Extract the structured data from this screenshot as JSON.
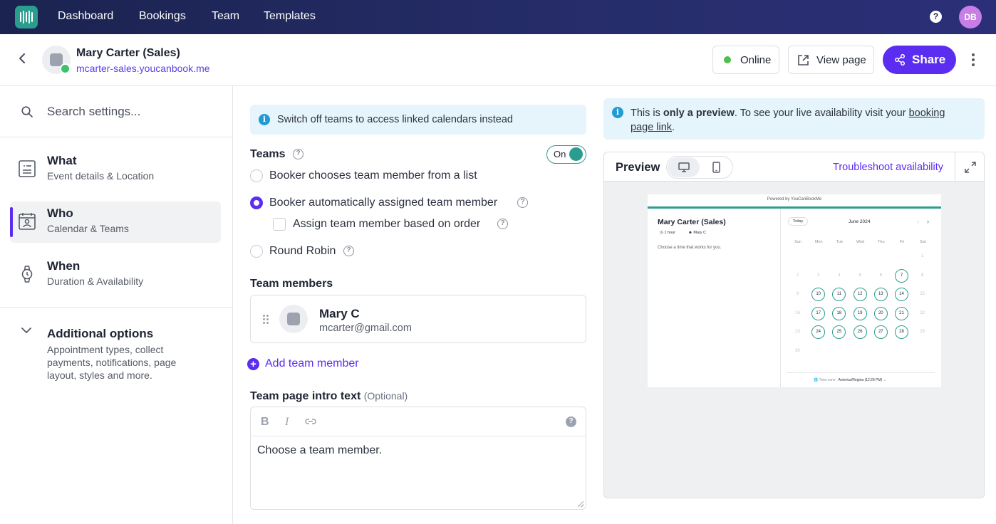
{
  "nav": {
    "items": [
      "Dashboard",
      "Bookings",
      "Team",
      "Templates"
    ],
    "help": "?",
    "avatar_initials": "DB"
  },
  "header": {
    "name": "Mary Carter (Sales)",
    "url": "mcarter-sales.youcanbook.me",
    "online_label": "Online",
    "view_page_label": "View page",
    "share_label": "Share"
  },
  "sidebar": {
    "search_placeholder": "Search settings...",
    "items": [
      {
        "title": "What",
        "subtitle": "Event details & Location"
      },
      {
        "title": "Who",
        "subtitle": "Calendar & Teams"
      },
      {
        "title": "When",
        "subtitle": "Duration & Availability"
      }
    ],
    "additional": {
      "title": "Additional options",
      "subtitle": "Appointment types, collect payments, notifications, page layout, styles and more."
    }
  },
  "teams": {
    "banner": "Switch off teams to access linked calendars instead",
    "label": "Teams",
    "toggle_label": "On",
    "options": [
      "Booker chooses team member from a list",
      "Booker automatically assigned team member",
      "Round Robin"
    ],
    "selected_option": 1,
    "sub_option": "Assign team member based on order",
    "members_label": "Team members",
    "members": [
      {
        "name": "Mary C",
        "email": "mcarter@gmail.com"
      }
    ],
    "add_member_label": "Add team member",
    "intro_label": "Team page intro text",
    "intro_optional": "(Optional)",
    "intro_text": "Choose a team member."
  },
  "preview": {
    "note_prefix": "This is ",
    "note_bold": "only a preview",
    "note_middle": ". To see your live availability visit your ",
    "note_link": "booking page link",
    "note_suffix": ".",
    "title": "Preview",
    "troubleshoot_label": "Troubleshoot availability",
    "mini": {
      "powered_by": "Powered by YouCanBookMe",
      "name": "Mary Carter (Sales)",
      "duration": "1 hour",
      "member": "Mary C",
      "choose_text": "Choose a time that works for you.",
      "today_label": "Today",
      "month": "June 2024",
      "weekdays": [
        "Sun",
        "Mon",
        "Tue",
        "Wed",
        "Thu",
        "Fri",
        "Sat"
      ],
      "first_weekday_index": 6,
      "days_in_month": 30,
      "available_days": [
        10,
        11,
        12,
        13,
        14,
        17,
        18,
        19,
        20,
        21,
        24,
        25,
        26,
        27,
        28
      ],
      "today": 7,
      "timezone_label": "Time zone",
      "timezone_value": "America/Regina (12:26 PM)"
    }
  },
  "colors": {
    "accent": "#5b2df0",
    "teal": "#2a9d8f",
    "nav_bg": "#1b2350",
    "info_bg": "#e6f5fb"
  }
}
